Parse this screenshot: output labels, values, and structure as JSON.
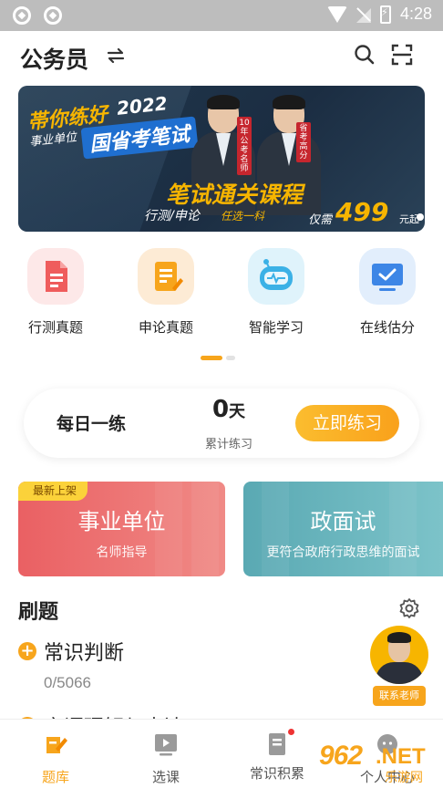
{
  "status_bar": {
    "time": "4:28"
  },
  "header": {
    "title": "公务员"
  },
  "banner": {
    "line1": "帯你练好",
    "year": "2022",
    "line2": "事业单位",
    "line3": "国省考笔试",
    "badge_left": "10年公考名师",
    "badge_right": "省考高分",
    "course": "笔试通关课程",
    "sub": "行测/申论",
    "sub_hint": "任选一科",
    "price_prefix": "仅需",
    "price": "499",
    "price_suffix": "元起"
  },
  "quick_entries": [
    {
      "label": "行测真题",
      "icon": "document-icon"
    },
    {
      "label": "申论真题",
      "icon": "note-edit-icon"
    },
    {
      "label": "智能学习",
      "icon": "robot-icon"
    },
    {
      "label": "在线估分",
      "icon": "monitor-check-icon"
    }
  ],
  "daily": {
    "title": "每日一练",
    "days": "0",
    "days_unit": "天",
    "days_label": "累计练习",
    "button": "立即练习"
  },
  "cards": [
    {
      "badge": "最新上架",
      "title": "事业单位",
      "subtitle": "名师指导"
    },
    {
      "title": "政面试",
      "subtitle": "更符合政府行政思维的面试"
    }
  ],
  "practice": {
    "title": "刷题",
    "items": [
      {
        "title": "常识判断",
        "count": "0/5066"
      },
      {
        "title": "言语理解与表达"
      }
    ]
  },
  "contact": {
    "label": "联系老师"
  },
  "tabbar": [
    {
      "label": "题库",
      "active": true
    },
    {
      "label": "选课"
    },
    {
      "label": "常识积累"
    },
    {
      "label": "个人中心"
    }
  ],
  "watermark": {
    "brand": "962",
    "domain": ".NET",
    "cn": "乐游网"
  },
  "colors": {
    "accent": "#f7a51c",
    "card_red": "#ea6063",
    "card_teal": "#5aa9b3",
    "banner_bg": "#21384e"
  }
}
